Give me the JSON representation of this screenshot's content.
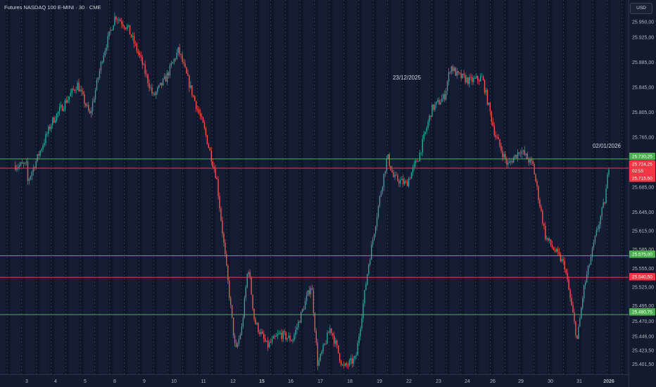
{
  "header": {
    "title": "Futures NASDAQ 100 E-MINI · 30 · CME",
    "currency": "USD"
  },
  "colors": {
    "background": "#151d35",
    "session_band": "#0f1628",
    "up": "#26a69a",
    "down": "#ef5350",
    "support": "#4caf50",
    "resistance": "#f23645",
    "vgrid": "#6b7a99"
  },
  "chart_data": {
    "type": "candlestick",
    "interval": "30",
    "symbol": "Futures NASDAQ 100 E-MINI",
    "exchange": "CME",
    "y_axis": {
      "position": "right",
      "ylim": [
        25385,
        25985
      ],
      "tick_values": [
        25950,
        25925,
        25885,
        25845,
        25805,
        25765,
        25685,
        25645,
        25615,
        25585,
        25555,
        25525,
        25495,
        25470,
        25446,
        25423.5,
        25401.5
      ],
      "tick_labels": [
        "25.950,00",
        "25.925,00",
        "25.885,00",
        "25.845,00",
        "25.805,00",
        "25.765,00",
        "25.685,00",
        "25.645,00",
        "25.615,00",
        "25.585,00",
        "25.555,00",
        "25.525,00",
        "25.495,00",
        "25.470,00",
        "25.446,00",
        "25.423,50",
        "25.401,50"
      ]
    },
    "x_axis": {
      "day_labels": [
        "3",
        "4",
        "5",
        "8",
        "9",
        "10",
        "11",
        "12",
        "15",
        "16",
        "17",
        "18",
        "19",
        "22",
        "23",
        "24",
        "26",
        "29",
        "30",
        "31",
        "2026"
      ],
      "bold_labels": [
        "15",
        "2026"
      ]
    },
    "horizontal_levels": [
      {
        "price": 25730.25,
        "label": "25.730,25",
        "kind": "support"
      },
      {
        "price": 25724.25,
        "label": "25.724,25",
        "kind": "resistance"
      },
      {
        "price": 25715.5,
        "label": "25.715,50",
        "kind": "resistance"
      },
      {
        "price": 25575.0,
        "label": "25.575,00",
        "kind": "support"
      },
      {
        "price": 25540.5,
        "label": "25.540,50",
        "kind": "resistance"
      },
      {
        "price": 25480.75,
        "label": "25.480,75",
        "kind": "support"
      }
    ],
    "countdown": "02:55",
    "annotations": [
      {
        "text": "23/12/2025",
        "near_day": "23"
      },
      {
        "text": "02/01/2026",
        "near_day": "2026"
      }
    ],
    "close_path": [
      [
        0.0,
        25690
      ],
      [
        2.0,
        25790
      ],
      [
        4.0,
        25850
      ],
      [
        5.0,
        25800
      ],
      [
        6.0,
        25895
      ],
      [
        7.0,
        25960
      ],
      [
        8.0,
        25940
      ],
      [
        9.0,
        25890
      ],
      [
        10.0,
        25830
      ],
      [
        11.0,
        25860
      ],
      [
        12.0,
        25905
      ],
      [
        13.0,
        25840
      ],
      [
        14.0,
        25780
      ],
      [
        15.0,
        25700
      ],
      [
        16.5,
        25420
      ],
      [
        17.0,
        25460
      ],
      [
        17.5,
        25560
      ],
      [
        18.0,
        25470
      ],
      [
        19.0,
        25430
      ],
      [
        20.0,
        25450
      ],
      [
        21.0,
        25440
      ],
      [
        22.5,
        25530
      ],
      [
        23.0,
        25400
      ],
      [
        24.0,
        25460
      ],
      [
        25.0,
        25395
      ],
      [
        26.0,
        25410
      ],
      [
        27.0,
        25560
      ],
      [
        28.0,
        25680
      ],
      [
        28.5,
        25735
      ],
      [
        29.0,
        25700
      ],
      [
        30.0,
        25690
      ],
      [
        31.0,
        25735
      ],
      [
        32.0,
        25810
      ],
      [
        33.0,
        25830
      ],
      [
        33.5,
        25880
      ],
      [
        34.0,
        25865
      ],
      [
        35.0,
        25855
      ],
      [
        36.0,
        25860
      ],
      [
        37.0,
        25770
      ],
      [
        38.0,
        25720
      ],
      [
        39.0,
        25745
      ],
      [
        40.0,
        25720
      ],
      [
        41.0,
        25605
      ],
      [
        42.0,
        25575
      ],
      [
        42.5,
        25560
      ],
      [
        43.0,
        25500
      ],
      [
        43.5,
        25440
      ],
      [
        44.0,
        25520
      ],
      [
        45.0,
        25610
      ],
      [
        45.7,
        25665
      ],
      [
        46.0,
        25720
      ]
    ]
  }
}
